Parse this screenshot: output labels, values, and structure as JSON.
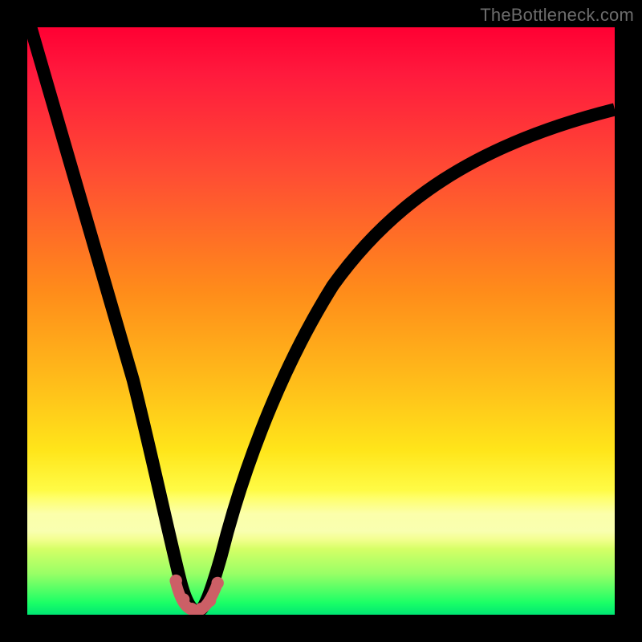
{
  "watermark": "TheBottleneck.com",
  "chart_data": {
    "type": "line",
    "title": "",
    "xlabel": "",
    "ylabel": "",
    "xlim": [
      0,
      100
    ],
    "ylim": [
      0,
      100
    ],
    "grid": false,
    "legend": "none",
    "series": [
      {
        "name": "curve",
        "x": [
          0,
          4,
          8,
          12,
          16,
          20,
          23,
          25.5,
          27,
          28.5,
          30,
          31,
          34,
          38,
          44,
          52,
          62,
          74,
          88,
          100
        ],
        "y": [
          102,
          84,
          66,
          49,
          33,
          18,
          8,
          2,
          0,
          0,
          2,
          6,
          18,
          32,
          46,
          58,
          68,
          76,
          82,
          86
        ]
      },
      {
        "name": "highlight-bottom",
        "x": [
          25.5,
          27,
          28.5,
          30,
          31.5
        ],
        "y": [
          2,
          0,
          0,
          2,
          4
        ]
      }
    ],
    "colors": {
      "gradient_top": "#ff0033",
      "gradient_mid1": "#ff8c1a",
      "gradient_mid2": "#ffff4d",
      "gradient_bottom": "#00e673",
      "curve": "#000000",
      "highlight": "#cc5f66"
    }
  }
}
